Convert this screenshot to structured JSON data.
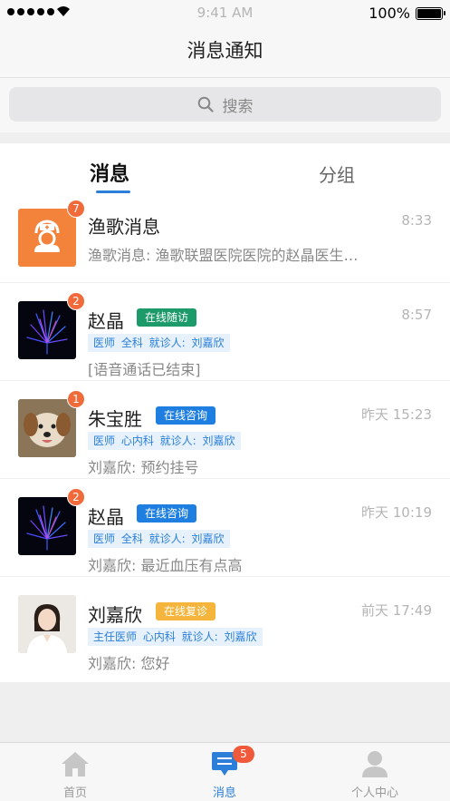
{
  "status_bar": {
    "time": "9:41 AM",
    "battery": "100%"
  },
  "header": {
    "title": "消息通知"
  },
  "search": {
    "placeholder": "搜索"
  },
  "tabs": [
    {
      "label": "消息"
    },
    {
      "label": "分组"
    }
  ],
  "conversations": [
    {
      "name": "渔歌消息",
      "badge": "7",
      "time": "8:33",
      "preview": "渔歌消息: 渔歌联盟医院医院的赵晶医生…",
      "avatar": "nurse-icon"
    },
    {
      "name": "赵晶",
      "badge": "2",
      "tag": "在线随访",
      "tag_color": "#1c9a6a",
      "meta": "医师 全科 就诊人: 刘嘉欣",
      "time": "8:57",
      "preview": "[语音通话已结束]",
      "avatar": "firework-image"
    },
    {
      "name": "朱宝胜",
      "badge": "1",
      "tag": "在线咨询",
      "tag_color": "#1f7fe0",
      "meta": "医师 心内科 就诊人: 刘嘉欣",
      "time": "昨天 15:23",
      "preview": "刘嘉欣: 预约挂号",
      "avatar": "dog-photo"
    },
    {
      "name": "赵晶",
      "badge": "2",
      "tag": "在线咨询",
      "tag_color": "#1f7fe0",
      "meta": "医师 全科 就诊人: 刘嘉欣",
      "time": "昨天 10:19",
      "preview": "刘嘉欣: 最近血压有点高",
      "avatar": "firework-image"
    },
    {
      "name": "刘嘉欣",
      "tag": "在线复诊",
      "tag_color": "#f5b53d",
      "meta": "主任医师 心内科 就诊人: 刘嘉欣",
      "time": "前天 17:49",
      "preview": "刘嘉欣: 您好",
      "avatar": "doctor-photo"
    }
  ],
  "tabbar": {
    "items": [
      {
        "label": "首页",
        "icon": "home-icon"
      },
      {
        "label": "消息",
        "icon": "message-icon",
        "badge": "5",
        "active": true
      },
      {
        "label": "个人中心",
        "icon": "user-icon"
      }
    ]
  },
  "colors": {
    "accent": "#2b7fd9",
    "badge": "#f06a3a"
  }
}
